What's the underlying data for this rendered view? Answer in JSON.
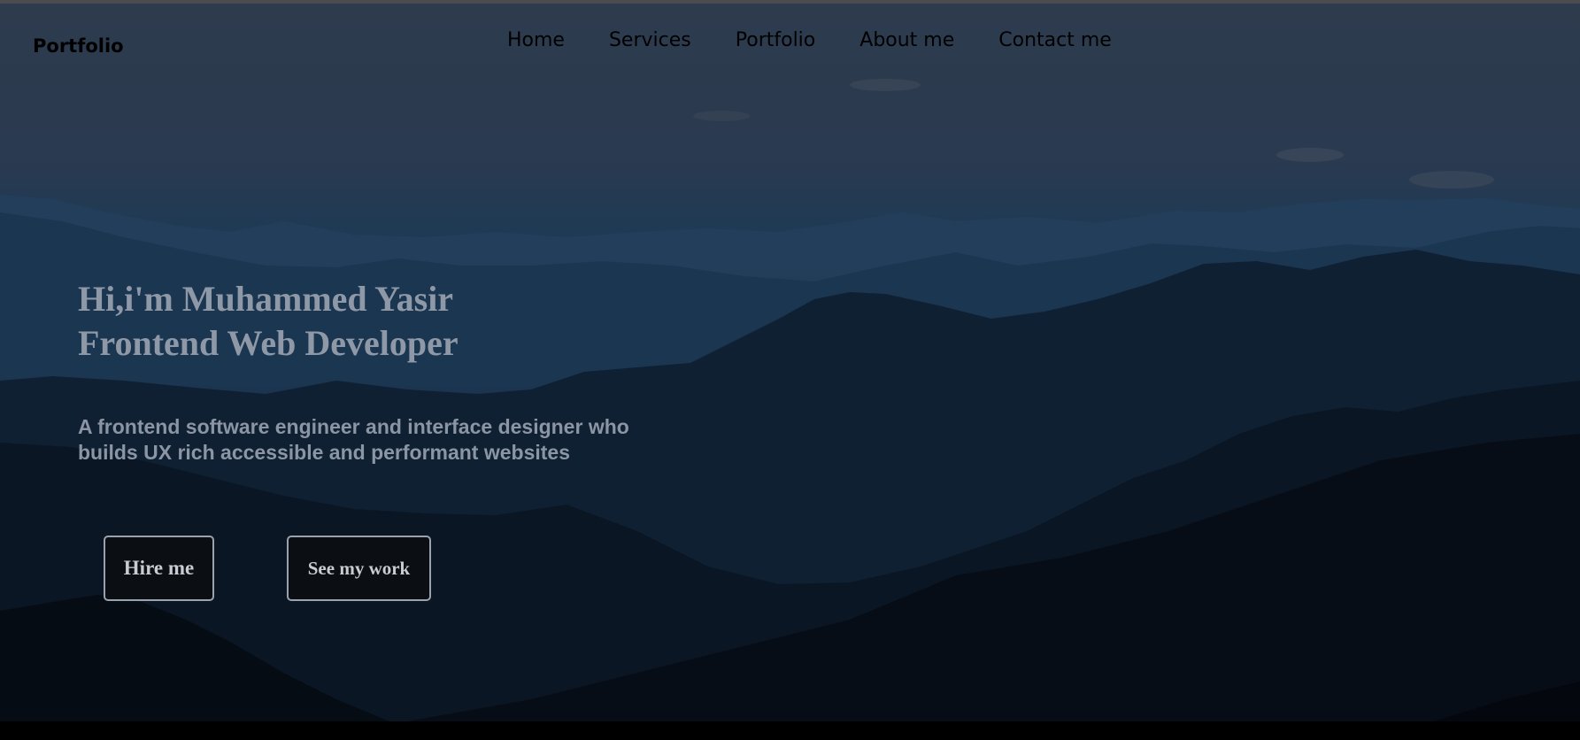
{
  "header": {
    "brand": "Portfolio",
    "nav": [
      {
        "label": "Home"
      },
      {
        "label": "Services"
      },
      {
        "label": "Portfolio"
      },
      {
        "label": "About me"
      },
      {
        "label": "Contact me"
      }
    ]
  },
  "hero": {
    "headline_line1": "Hi,i'm Muhammed Yasir",
    "headline_line2": "Frontend Web Developer",
    "description": "A frontend software engineer and interface designer who builds UX rich accessible and performant websites",
    "buttons": {
      "hire_label": "Hire me",
      "work_label": "See my work"
    }
  },
  "colors": {
    "sky_top": "#2e3b4d",
    "mountain_dark": "#080f18",
    "text_muted": "#8e98a6",
    "button_border": "#9aa2ad"
  }
}
